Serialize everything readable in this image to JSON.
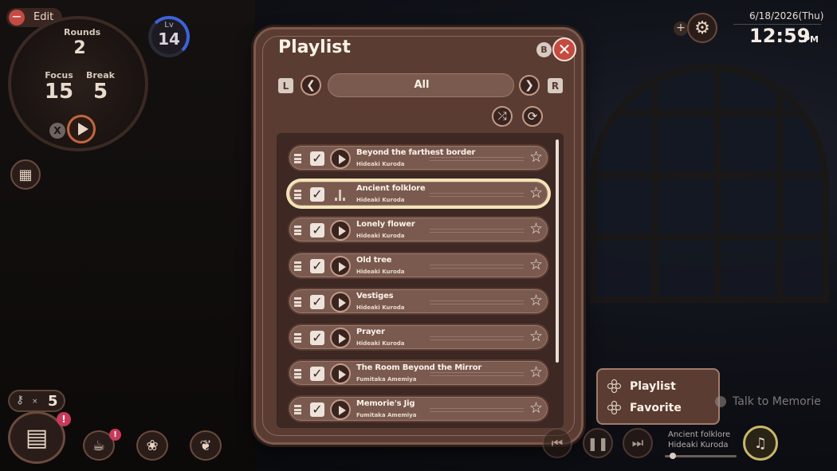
{
  "hud": {
    "edit_label": "Edit",
    "rounds_label": "Rounds",
    "rounds_value": "2",
    "focus_label": "Focus",
    "focus_value": "15",
    "break_label": "Break",
    "break_value": "5",
    "level_label": "Lv",
    "level_value": "14",
    "keys_count": "5",
    "x_button": "X"
  },
  "clock": {
    "date": "6/18/2026(Thu)",
    "time": "12:59",
    "ampm": "PM"
  },
  "playlist": {
    "title": "Playlist",
    "close_key": "B",
    "left_key": "L",
    "right_key": "R",
    "filter_value": "All",
    "tracks": [
      {
        "title": "Beyond the farthest border",
        "artist": "Hideaki Kuroda",
        "checked": true,
        "state": "play"
      },
      {
        "title": "Ancient folklore",
        "artist": "Hideaki Kuroda",
        "checked": true,
        "state": "playing"
      },
      {
        "title": "Lonely flower",
        "artist": "Hideaki Kuroda",
        "checked": true,
        "state": "play"
      },
      {
        "title": "Old tree",
        "artist": "Hideaki Kuroda",
        "checked": true,
        "state": "play"
      },
      {
        "title": "Vestiges",
        "artist": "Hideaki Kuroda",
        "checked": true,
        "state": "play"
      },
      {
        "title": "Prayer",
        "artist": "Hideaki Kuroda",
        "checked": true,
        "state": "play"
      },
      {
        "title": "The Room Beyond the Mirror",
        "artist": "Fumitaka Amemiya",
        "checked": true,
        "state": "play"
      },
      {
        "title": "Memorie's Jig",
        "artist": "Fumitaka Amemiya",
        "checked": true,
        "state": "play"
      }
    ]
  },
  "popup_menu": {
    "items": [
      "Playlist",
      "Favorite"
    ]
  },
  "talk": {
    "label": "Talk to Memorie"
  },
  "now_playing": {
    "title": "Ancient folklore",
    "artist": "Hideaki Kuroda"
  },
  "colors": {
    "panel": "#5a3c33",
    "row": "#7a5a4f",
    "highlight": "#f3e4b8",
    "level_ring": "#3d63d8"
  }
}
